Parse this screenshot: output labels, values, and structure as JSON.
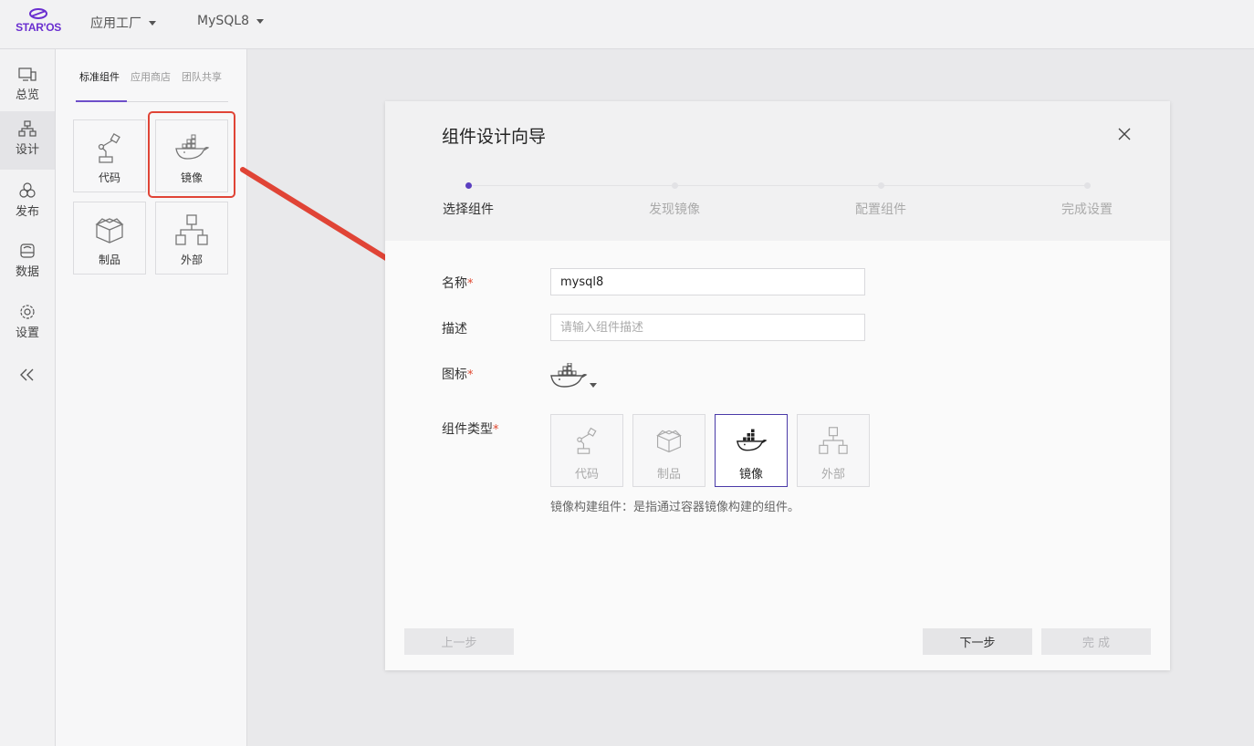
{
  "brand": {
    "logo_text": "STAR'OS",
    "accent": "#6e4fc9"
  },
  "topbar": {
    "menus": [
      {
        "label": "应用工厂"
      },
      {
        "label": "MySQL8"
      }
    ]
  },
  "sidebar": {
    "items": [
      {
        "label": "总览",
        "icon": "monitor-icon"
      },
      {
        "label": "设计",
        "icon": "hierarchy-icon"
      },
      {
        "label": "发布",
        "icon": "circles-icon"
      },
      {
        "label": "数据",
        "icon": "drive-icon"
      },
      {
        "label": "设置",
        "icon": "gear-icon"
      }
    ],
    "collapse_icon": "double-chevron-left-icon"
  },
  "panel": {
    "tabs": [
      {
        "label": "标准组件"
      },
      {
        "label": "应用商店"
      },
      {
        "label": "团队共享"
      }
    ],
    "components": [
      {
        "label": "代码",
        "icon": "robot-arm-icon"
      },
      {
        "label": "镜像",
        "icon": "docker-whale-icon"
      },
      {
        "label": "制品",
        "icon": "package-box-icon"
      },
      {
        "label": "外部",
        "icon": "hierarchy-icon"
      }
    ]
  },
  "dialog": {
    "title": "组件设计向导",
    "steps": [
      {
        "label": "选择组件",
        "active": true
      },
      {
        "label": "发现镜像",
        "active": false
      },
      {
        "label": "配置组件",
        "active": false
      },
      {
        "label": "完成设置",
        "active": false
      }
    ],
    "form": {
      "name_label": "名称",
      "name_value": "mysql8",
      "desc_label": "描述",
      "desc_placeholder": "请输入组件描述",
      "icon_label": "图标",
      "type_label": "组件类型",
      "required_mark": "*",
      "types": [
        {
          "label": "代码",
          "icon": "robot-arm-icon",
          "selected": false
        },
        {
          "label": "制品",
          "icon": "package-box-icon",
          "selected": false
        },
        {
          "label": "镜像",
          "icon": "docker-whale-icon",
          "selected": true
        },
        {
          "label": "外部",
          "icon": "hierarchy-icon",
          "selected": false
        }
      ],
      "type_description": "镜像构建组件：是指通过容器镜像构建的组件。"
    },
    "buttons": {
      "prev": "上一步",
      "next": "下一步",
      "finish": "完  成"
    }
  },
  "annotation": {
    "arrow_color": "#e04436"
  }
}
